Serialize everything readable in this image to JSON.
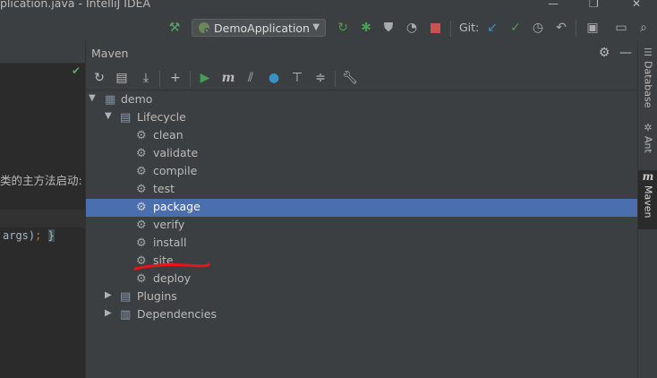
{
  "window": {
    "title": "plication.java - IntelliJ IDEA"
  },
  "toolbar": {
    "run_config": "DemoApplication",
    "git_label": "Git:"
  },
  "editor": {
    "comment_text": "类的主方法启动:",
    "code_args": "args)",
    "code_semicolon": ";",
    "code_brace": "}"
  },
  "maven_panel": {
    "title": "Maven",
    "tree": {
      "root": "demo",
      "lifecycle": {
        "label": "Lifecycle",
        "phases": [
          "clean",
          "validate",
          "compile",
          "test",
          "package",
          "verify",
          "install",
          "site",
          "deploy"
        ],
        "selected": "package"
      },
      "plugins": "Plugins",
      "dependencies": "Dependencies"
    }
  },
  "right_sidebar": {
    "tabs": [
      "Database",
      "Ant",
      "Maven"
    ],
    "active": "Maven"
  },
  "colors": {
    "selection": "#4b6eaf",
    "annotation_underline": "#e8141b",
    "panel_bg": "#3c3f41",
    "editor_bg": "#2b2b2b",
    "run_green": "#499c54"
  }
}
